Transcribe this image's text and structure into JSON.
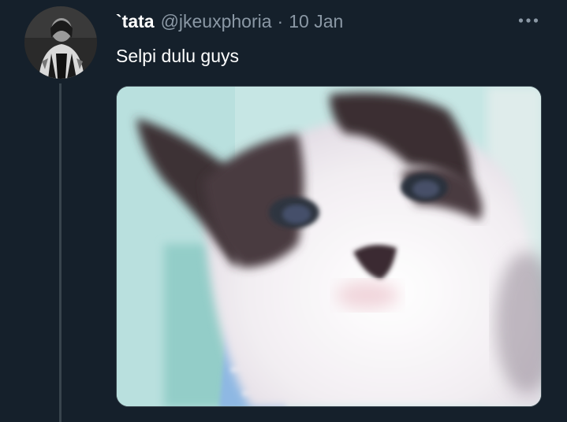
{
  "tweet": {
    "display_name": "`tata",
    "handle": "@jkeuxphoria",
    "separator": "·",
    "date": "10 Jan",
    "text": "Selpi dulu guys",
    "more_icon": "more-horizontal-icon",
    "media_subject": "photo"
  },
  "colors": {
    "background": "#15202b",
    "primary_text": "#ffffff",
    "secondary_text": "#8b98a5",
    "border": "#38444d"
  }
}
